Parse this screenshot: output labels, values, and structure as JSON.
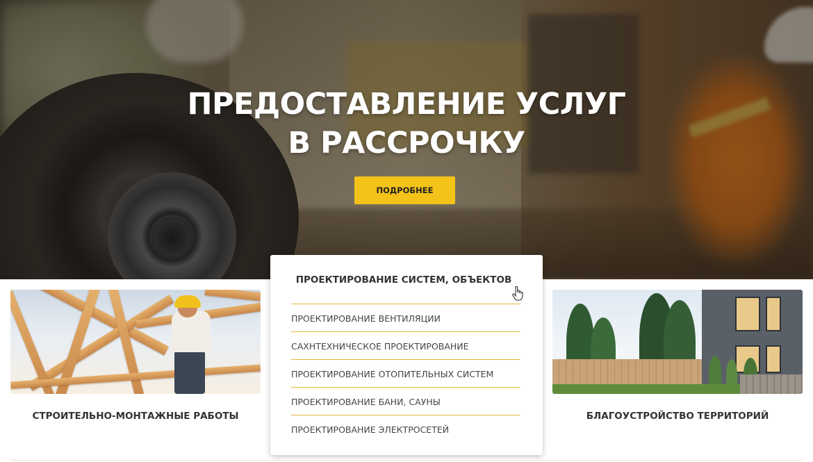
{
  "hero": {
    "title_line1": "ПРЕДОСТАВЛЕНИЕ УСЛУГ",
    "title_line2": "В РАССРОЧКУ",
    "button_label": "ПОДРОБНЕЕ"
  },
  "services": {
    "left_card": {
      "title": "СТРОИТЕЛЬНО-МОНТАЖНЫЕ РАБОТЫ"
    },
    "right_card": {
      "title": "БЛАГОУСТРОЙСТВО ТЕРРИТОРИЙ"
    },
    "center_panel": {
      "title": "ПРОЕКТИРОВАНИЕ СИСТЕМ, ОБЪЕКТОВ",
      "items": [
        "ПРОЕКТИРОВАНИЕ ВЕНТИЛЯЦИИ",
        "САХНТЕХНИЧЕСКОЕ ПРОЕКТИРОВАНИЕ",
        "ПРОЕКТИРОВАНИЕ ОТОПИТЕЛЬНЫХ СИСТЕМ",
        "ПРОЕКТИРОВАНИЕ БАНИ, САУНЫ",
        "ПРОЕКТИРОВАНИЕ ЭЛЕКТРОСЕТЕЙ"
      ]
    }
  },
  "colors": {
    "accent": "#f3c319",
    "rule": "#e4b93a",
    "text_dark": "#333333"
  },
  "icons": {
    "cursor": "hand-pointer-icon"
  }
}
